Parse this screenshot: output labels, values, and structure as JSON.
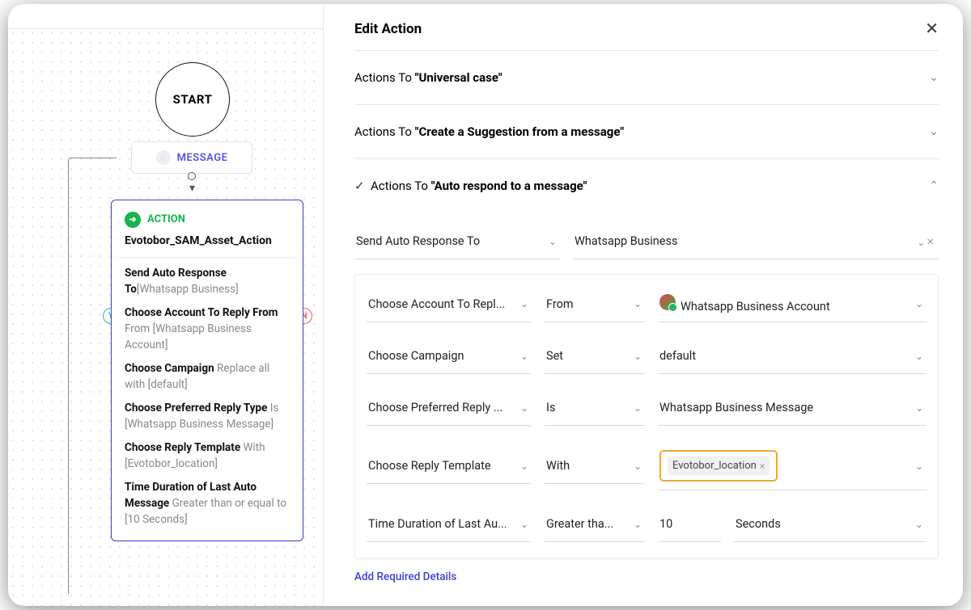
{
  "canvas": {
    "start_label": "START",
    "message_label": "MESSAGE",
    "action_label": "ACTION",
    "action_name": "Evotobor_SAM_Asset_Action",
    "yes_badge": "Y",
    "no_badge": "N",
    "props": [
      {
        "k": "Send Auto Response To",
        "v": "[Whatsapp Business]"
      },
      {
        "k": "Choose Account To Reply From",
        "v": " From [Whatsapp Business Account]"
      },
      {
        "k": "Choose Campaign",
        "v": " Replace all with [default]"
      },
      {
        "k": "Choose Preferred Reply Type",
        "v": " Is [Whatsapp Business Message]"
      },
      {
        "k": "Choose Reply Template",
        "v": " With [Evotobor_location]"
      },
      {
        "k": "Time Duration of Last Auto Message",
        "v": " Greater than or equal to [10 Seconds]"
      }
    ]
  },
  "panel": {
    "title": "Edit Action",
    "sections": {
      "s1_prefix": "Actions To ",
      "s1_bold": "\"Universal case\"",
      "s2_prefix": "Actions To ",
      "s2_bold": "\"Create a Suggestion from a message\"",
      "s3_prefix": "Actions To ",
      "s3_bold": "\"Auto respond to a message\""
    },
    "head_row": {
      "label": "Send Auto Response To",
      "value": "Whatsapp Business"
    },
    "rows": [
      {
        "label": "Choose Account To Repl...",
        "op": "From",
        "value": "Whatsapp Business Account",
        "icon": true
      },
      {
        "label": "Choose Campaign",
        "op": "Set",
        "value": "default"
      },
      {
        "label": "Choose Preferred Reply ...",
        "op": "Is",
        "value": "Whatsapp Business Message"
      },
      {
        "label": "Choose Reply Template",
        "op": "With",
        "chip": "Evotobor_location"
      },
      {
        "label": "Time Duration of Last Au...",
        "op": "Greater tha...",
        "num": "10",
        "unit": "Seconds"
      }
    ],
    "link": "Add Required Details"
  }
}
